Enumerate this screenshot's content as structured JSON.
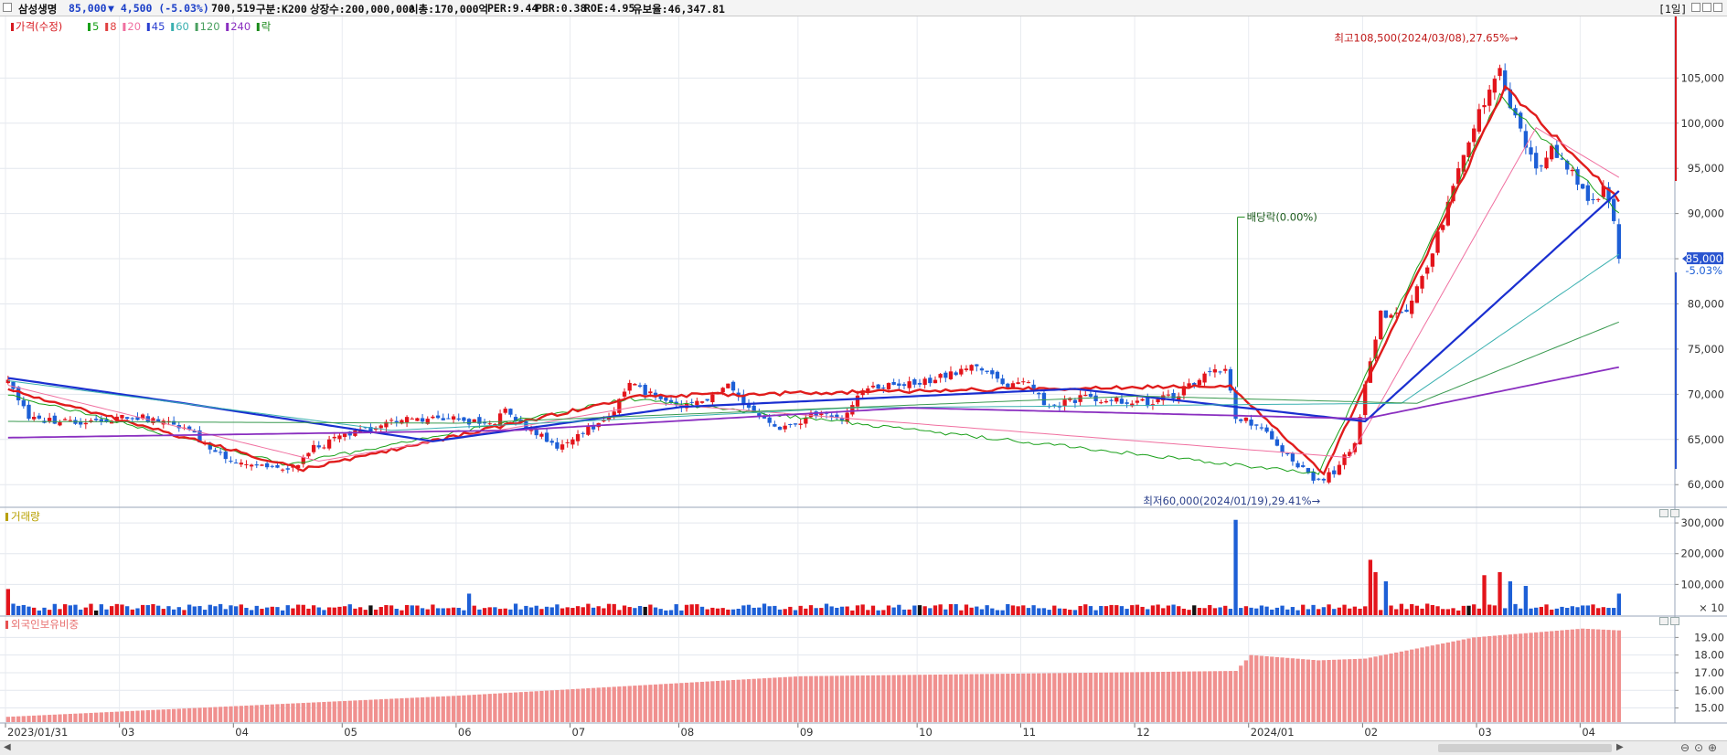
{
  "header": {
    "stock_name": "삼성생명",
    "price": "85,000",
    "change": "▼ 4,500 (-5.03%)",
    "volume": "700,519",
    "market": "구분:K200",
    "shares": "상장수:200,000,000",
    "market_cap": "시총:170,000억",
    "per": "PER:9.44",
    "pbr": "PBR:0.38",
    "roe": "ROE:4.95",
    "float": "유보율:46,347.81",
    "period": "[1일]"
  },
  "legend": [
    {
      "label": "가격(수정)",
      "color": "#d71920"
    },
    {
      "label": "5",
      "color": "#1aa01a"
    },
    {
      "label": "8",
      "color": "#e04040"
    },
    {
      "label": "20",
      "color": "#f070a0"
    },
    {
      "label": "45",
      "color": "#2a3fd0"
    },
    {
      "label": "60",
      "color": "#3ab0b0"
    },
    {
      "label": "120",
      "color": "#4aa060"
    },
    {
      "label": "240",
      "color": "#8a2fc0"
    },
    {
      "label": "락",
      "color": "#1a8a1a"
    }
  ],
  "annotations": {
    "high": "최고108,500(2024/03/08),27.65%→",
    "low": "최저60,000(2024/01/19),29.41%→",
    "dividend": "배당락(0.00%)",
    "current_price": "85,000",
    "current_change": "-5.03%"
  },
  "volume_panel": {
    "title": "거래량",
    "unit": "× 10"
  },
  "foreign_panel": {
    "title": "외국인보유비중"
  },
  "chart_data": [
    {
      "type": "candlestick",
      "title": "가격(수정)",
      "ylim": [
        58000,
        111000
      ],
      "yticks": [
        60000,
        65000,
        70000,
        75000,
        80000,
        85000,
        90000,
        95000,
        100000,
        105000
      ],
      "ytick_labels": [
        "60,000",
        "65,000",
        "70,000",
        "75,000",
        "80,000",
        "85,000",
        "90,000",
        "95,000",
        "100,000",
        "105,000"
      ],
      "x_start": "2023/01/31",
      "x_end": "2024/04/12",
      "x_tick_labels": [
        "2023/01/31",
        "03",
        "04",
        "05",
        "06",
        "07",
        "08",
        "09",
        "10",
        "11",
        "12",
        "2024/01",
        "02",
        "03",
        "04"
      ],
      "x_tick_dates": [
        "2023-01-31",
        "2023-03-02",
        "2023-04-03",
        "2023-05-02",
        "2023-06-01",
        "2023-07-03",
        "2023-08-01",
        "2023-09-01",
        "2023-10-04",
        "2023-11-01",
        "2023-12-01",
        "2024-01-02",
        "2024-02-01",
        "2024-03-04",
        "2024-04-01"
      ],
      "close_anchors": [
        [
          "2023-01-31",
          71800
        ],
        [
          "2023-02-06",
          67200
        ],
        [
          "2023-02-20",
          67000
        ],
        [
          "2023-03-06",
          67600
        ],
        [
          "2023-03-20",
          66400
        ],
        [
          "2023-03-27",
          64000
        ],
        [
          "2023-04-03",
          62600
        ],
        [
          "2023-04-07",
          62200
        ],
        [
          "2023-04-12",
          62000
        ],
        [
          "2023-04-17",
          61400
        ],
        [
          "2023-04-24",
          64000
        ],
        [
          "2023-05-02",
          65400
        ],
        [
          "2023-05-10",
          66400
        ],
        [
          "2023-05-19",
          67400
        ],
        [
          "2023-06-01",
          67200
        ],
        [
          "2023-06-09",
          66600
        ],
        [
          "2023-06-14",
          68000
        ],
        [
          "2023-06-20",
          66600
        ],
        [
          "2023-06-28",
          64000
        ],
        [
          "2023-07-04",
          65600
        ],
        [
          "2023-07-12",
          67400
        ],
        [
          "2023-07-18",
          71400
        ],
        [
          "2023-07-25",
          69600
        ],
        [
          "2023-08-01",
          68400
        ],
        [
          "2023-08-08",
          69400
        ],
        [
          "2023-08-14",
          70800
        ],
        [
          "2023-08-21",
          67800
        ],
        [
          "2023-08-28",
          65800
        ],
        [
          "2023-09-05",
          67800
        ],
        [
          "2023-09-13",
          67400
        ],
        [
          "2023-09-20",
          70800
        ],
        [
          "2023-10-04",
          71200
        ],
        [
          "2023-10-12",
          72400
        ],
        [
          "2023-10-19",
          73200
        ],
        [
          "2023-10-26",
          71000
        ],
        [
          "2023-11-01",
          71600
        ],
        [
          "2023-11-08",
          68600
        ],
        [
          "2023-11-16",
          69600
        ],
        [
          "2023-11-24",
          69400
        ],
        [
          "2023-12-05",
          69000
        ],
        [
          "2023-12-12",
          69800
        ],
        [
          "2023-12-19",
          71600
        ],
        [
          "2023-12-26",
          73000
        ],
        [
          "2023-12-28",
          67600
        ],
        [
          "2024-01-05",
          66000
        ],
        [
          "2024-01-11",
          63200
        ],
        [
          "2024-01-19",
          60300
        ],
        [
          "2024-01-24",
          61400
        ],
        [
          "2024-01-30",
          64800
        ],
        [
          "2024-02-02",
          74000
        ],
        [
          "2024-02-06",
          78800
        ],
        [
          "2024-02-13",
          79400
        ],
        [
          "2024-02-19",
          84000
        ],
        [
          "2024-02-23",
          91000
        ],
        [
          "2024-02-27",
          95400
        ],
        [
          "2024-03-04",
          101000
        ],
        [
          "2024-03-08",
          106200
        ],
        [
          "2024-03-12",
          102000
        ],
        [
          "2024-03-15",
          97600
        ],
        [
          "2024-03-19",
          95000
        ],
        [
          "2024-03-22",
          97000
        ],
        [
          "2024-03-26",
          96400
        ],
        [
          "2024-03-29",
          93400
        ],
        [
          "2024-04-03",
          91000
        ],
        [
          "2024-04-05",
          92600
        ],
        [
          "2024-04-09",
          89600
        ],
        [
          "2024-04-10",
          85000
        ]
      ],
      "moving_averages": {
        "5": [
          [
            "2023-01-31",
            70000
          ],
          [
            "2023-04-17",
            62200
          ],
          [
            "2023-07-18",
            69500
          ],
          [
            "2024-01-19",
            61200
          ],
          [
            "2024-03-08",
            103000
          ],
          [
            "2024-04-10",
            90000
          ]
        ],
        "8": [
          [
            "2023-01-31",
            70500
          ],
          [
            "2023-04-20",
            61700
          ],
          [
            "2023-07-20",
            69800
          ],
          [
            "2023-12-27",
            71000
          ],
          [
            "2024-01-22",
            61200
          ],
          [
            "2024-03-11",
            104000
          ],
          [
            "2024-04-10",
            91500
          ]
        ],
        "20": [
          [
            "2023-01-31",
            71000
          ],
          [
            "2023-04-25",
            62600
          ],
          [
            "2023-07-25",
            69000
          ],
          [
            "2024-01-29",
            63000
          ],
          [
            "2024-03-19",
            99500
          ],
          [
            "2024-04-10",
            94000
          ]
        ],
        "45": [
          [
            "2023-01-31",
            71800
          ],
          [
            "2023-03-20",
            69000
          ],
          [
            "2023-05-25",
            64800
          ],
          [
            "2023-08-01",
            68600
          ],
          [
            "2023-11-15",
            70600
          ],
          [
            "2024-02-01",
            67000
          ],
          [
            "2024-04-10",
            92500
          ]
        ],
        "60": [
          [
            "2023-01-31",
            71500
          ],
          [
            "2023-05-15",
            66000
          ],
          [
            "2023-09-15",
            68500
          ],
          [
            "2024-02-10",
            69000
          ],
          [
            "2024-04-10",
            85500
          ]
        ],
        "120": [
          [
            "2023-01-31",
            67000
          ],
          [
            "2023-06-01",
            66800
          ],
          [
            "2023-12-01",
            69800
          ],
          [
            "2024-02-15",
            69000
          ],
          [
            "2024-04-10",
            78000
          ]
        ],
        "240": [
          [
            "2023-01-31",
            65200
          ],
          [
            "2023-06-15",
            66000
          ],
          [
            "2023-10-01",
            68500
          ],
          [
            "2024-02-01",
            67300
          ],
          [
            "2024-04-10",
            73000
          ]
        ]
      },
      "high": {
        "date": "2024-03-08",
        "value": 108500
      },
      "low": {
        "date": "2024-01-19",
        "value": 60000
      },
      "last": {
        "date": "2024-04-10",
        "value": 85000
      }
    },
    {
      "type": "bar",
      "title": "거래량",
      "ylim": [
        0,
        330000
      ],
      "yticks": [
        100000,
        200000,
        300000
      ],
      "ytick_labels": [
        "100,000",
        "200,000",
        "300,000"
      ],
      "spikes": [
        [
          "2023-01-31",
          85000
        ],
        [
          "2023-06-05",
          70000
        ],
        [
          "2023-12-28",
          310000
        ],
        [
          "2024-02-02",
          180000
        ],
        [
          "2024-02-05",
          140000
        ],
        [
          "2024-02-07",
          110000
        ],
        [
          "2024-03-05",
          130000
        ],
        [
          "2024-03-08",
          140000
        ],
        [
          "2024-03-12",
          110000
        ],
        [
          "2024-03-15",
          95000
        ],
        [
          "2024-04-10",
          70000
        ]
      ],
      "baseline_volume": 25000
    },
    {
      "type": "bar",
      "title": "외국인보유비중",
      "ylim": [
        14.2,
        19.9
      ],
      "yticks": [
        15,
        16,
        17,
        18,
        19
      ],
      "ytick_labels": [
        "15.00",
        "16.00",
        "17.00",
        "18.00",
        "19.00"
      ],
      "anchors": [
        [
          "2023-01-31",
          14.5
        ],
        [
          "2023-06-01",
          15.7
        ],
        [
          "2023-09-01",
          16.8
        ],
        [
          "2023-12-28",
          17.1
        ],
        [
          "2024-01-02",
          18.0
        ],
        [
          "2024-01-19",
          17.7
        ],
        [
          "2024-02-01",
          17.8
        ],
        [
          "2024-03-01",
          19.0
        ],
        [
          "2024-04-01",
          19.5
        ],
        [
          "2024-04-10",
          19.4
        ]
      ]
    }
  ]
}
